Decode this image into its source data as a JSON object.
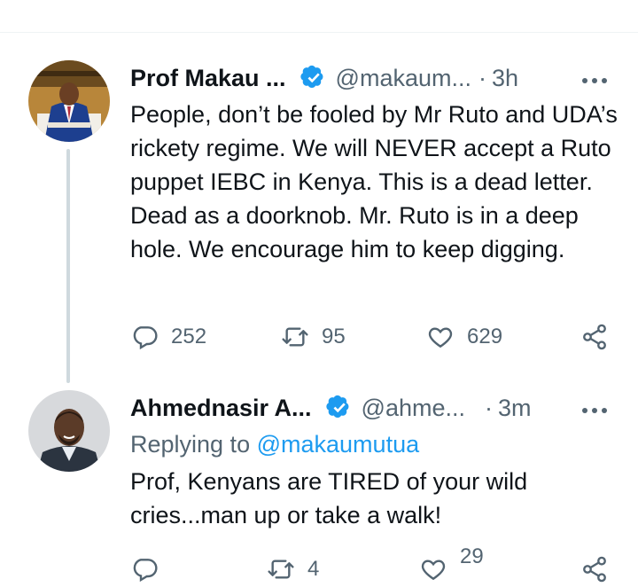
{
  "tweets": [
    {
      "display_name": "Prof Makau ...",
      "handle": "@makaum...",
      "separator": "·",
      "time": "3h",
      "more_label": "•••",
      "body": "People, don’t be fooled by Mr Ruto and UDA’s rickety regime.  We will NEVER accept a Ruto puppet IEBC in Kenya.  This is a dead letter.  Dead as a doorknob.  Mr. Ruto is in a deep hole.  We encourage him to keep digging.",
      "stats": {
        "replies": "252",
        "retweets": "95",
        "likes": "629"
      }
    },
    {
      "display_name": "Ahmednasir A...",
      "handle": "@ahme...",
      "separator": "·",
      "time": "3m",
      "more_label": "•••",
      "replying_prefix": "Replying to",
      "replying_to": "@makaumutua",
      "body": "Prof, Kenyans are TIRED of your wild cries...man up or take a walk!",
      "stats": {
        "retweets": "4",
        "likes": "29"
      }
    }
  ],
  "icons": {
    "verified": "verified-badge-icon",
    "reply": "reply-icon",
    "retweet": "retweet-icon",
    "like": "heart-icon",
    "share": "share-icon",
    "more": "more-icon"
  },
  "colors": {
    "verified_blue": "#1d9bf0",
    "text_primary": "#0f1419",
    "text_secondary": "#536471",
    "thread_line": "#cfd9de"
  }
}
